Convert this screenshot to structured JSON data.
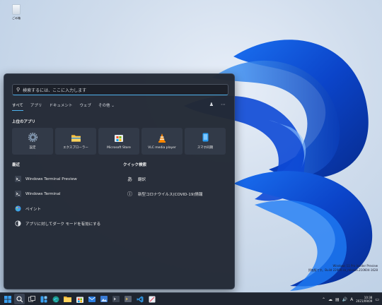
{
  "desktop": {
    "recycle_bin_label": "ごみ箱",
    "watermark_line1": "Windows 11 Pro Insider Preview",
    "watermark_line2": "評価版です。Build 22000.co_release.210604-1628"
  },
  "start_menu": {
    "search_placeholder": "検索するには、ここに入力します",
    "tabs": [
      {
        "label": "すべて",
        "active": true
      },
      {
        "label": "アプリ",
        "active": false
      },
      {
        "label": "ドキュメント",
        "active": false
      },
      {
        "label": "ウェブ",
        "active": false
      },
      {
        "label": "その他 ⌄",
        "active": false
      }
    ],
    "top_apps_title": "上位のアプリ",
    "top_apps": [
      {
        "label": "設定",
        "icon": "settings-gear-icon"
      },
      {
        "label": "エクスプローラー",
        "icon": "folder-icon"
      },
      {
        "label": "Microsoft Store",
        "icon": "store-icon"
      },
      {
        "label": "VLC media player",
        "icon": "vlc-cone-icon"
      },
      {
        "label": "スマホ同期",
        "icon": "phone-link-icon"
      }
    ],
    "recent_title": "最近",
    "recent": [
      {
        "label": "Windows Terminal Preview",
        "icon": "terminal-icon"
      },
      {
        "label": "Windows Terminal",
        "icon": "terminal-icon"
      },
      {
        "label": "ペイント",
        "icon": "paint-icon"
      },
      {
        "label": "アプリに対してダーク モードを有効にする",
        "icon": "theme-icon"
      }
    ],
    "quick_title": "クイック検索",
    "quick": [
      {
        "label": "翻訳",
        "glyph": "あ"
      },
      {
        "label": "新型コロナウイルス(COVID-19)情報",
        "glyph": "ⓘ"
      }
    ]
  },
  "taskbar": {
    "time": "10:38",
    "date": "2021/09/09",
    "ime": "A",
    "colors": {
      "accent": "#4fb3f0",
      "bar": "#1f2530"
    }
  }
}
